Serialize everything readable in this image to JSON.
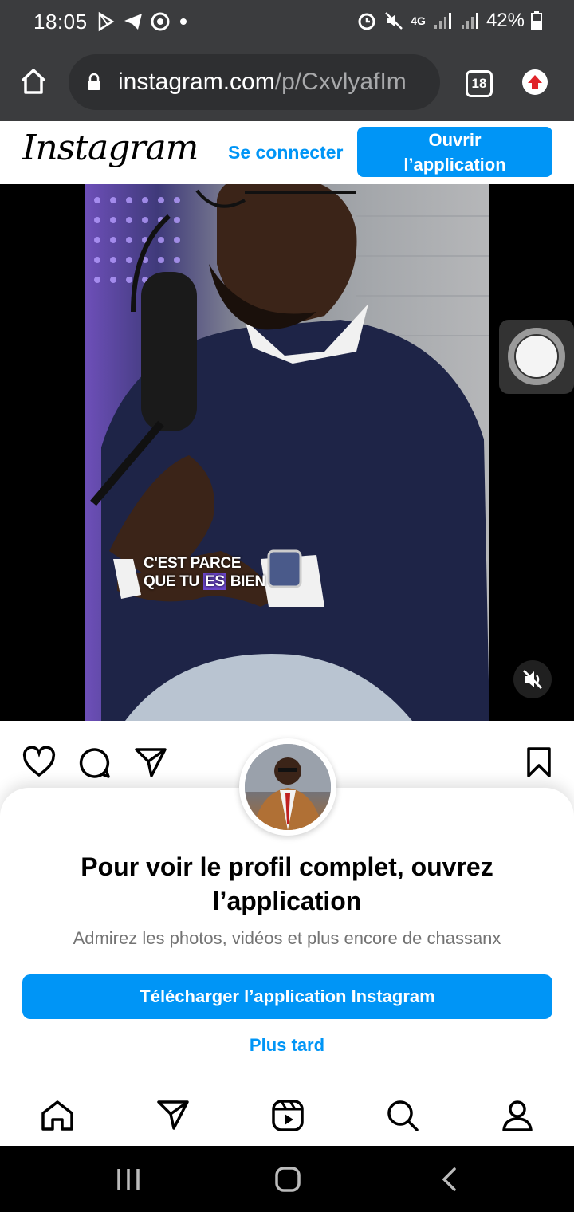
{
  "status_bar": {
    "time": "18:05",
    "battery": "42%",
    "network": "4G",
    "left_icons": [
      "play-store-icon",
      "telegram-icon",
      "target-icon",
      "dot-icon"
    ],
    "right_icons": [
      "alarm-icon",
      "mute-icon",
      "signal-icon",
      "signal-icon",
      "battery-icon"
    ]
  },
  "browser": {
    "url_host": "instagram.com",
    "url_path": "/p/CxvlyafIm",
    "tab_count": "18"
  },
  "ig_header": {
    "logo": "Instagram",
    "login_label": "Se connecter",
    "open_app_label_line1": "Ouvrir",
    "open_app_label_line2": "l’application"
  },
  "video": {
    "caption_line1": "C'EST PARCE",
    "caption_line2_a": "QUE TU ",
    "caption_line2_b": "ES",
    "caption_line2_c": " BIEN"
  },
  "sheet": {
    "title_line1": "Pour voir le profil complet, ouvrez",
    "title_line2": "l’application",
    "subtitle": "Admirez les photos, vidéos et plus encore de chassanx",
    "download_label": "Télécharger l’application Instagram",
    "later_label": "Plus tard"
  },
  "colors": {
    "accent": "#0095f6",
    "chrome_bar": "#3b3c3e",
    "caption_highlight": "#6a45c8"
  }
}
